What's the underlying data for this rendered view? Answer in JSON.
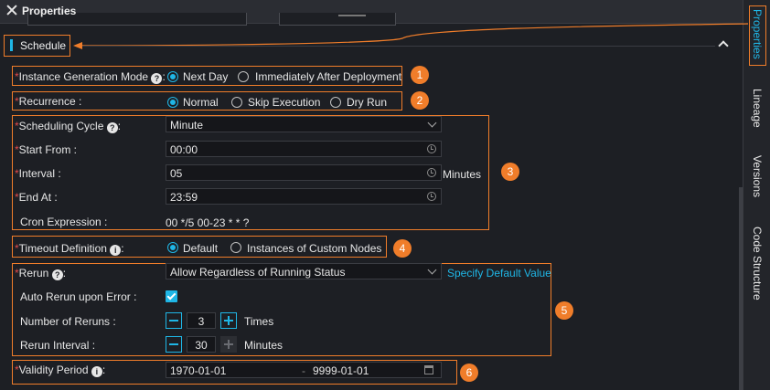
{
  "header": {
    "title": "Properties"
  },
  "sidebar": {
    "tabs": [
      {
        "label": "Properties",
        "active": true
      },
      {
        "label": "Lineage",
        "active": false
      },
      {
        "label": "Versions",
        "active": false
      },
      {
        "label": "Code Structure",
        "active": false
      }
    ]
  },
  "section": {
    "title": "Schedule"
  },
  "badges": [
    "1",
    "2",
    "3",
    "4",
    "5",
    "6"
  ],
  "instance_mode": {
    "label": "Instance Generation Mode",
    "help": "?",
    "options": [
      "Next Day",
      "Immediately After Deployment"
    ],
    "selected": "Next Day"
  },
  "recurrence": {
    "label": "Recurrence :",
    "options": [
      "Normal",
      "Skip Execution",
      "Dry Run"
    ],
    "selected": "Normal"
  },
  "cycle": {
    "scheduling_label": "Scheduling Cycle",
    "help": "?",
    "scheduling_value": "Minute",
    "start_label": "Start From :",
    "start_value": "00:00",
    "interval_label": "Interval :",
    "interval_value": "05",
    "interval_unit": "Minutes",
    "end_label": "End At :",
    "end_value": "23:59",
    "cron_label": "Cron Expression :",
    "cron_value": "00 */5 00-23 * * ?"
  },
  "timeout": {
    "label": "Timeout Definition",
    "help": "i",
    "options": [
      "Default",
      "Instances of Custom Nodes"
    ],
    "selected": "Default"
  },
  "rerun": {
    "label": "Rerun",
    "help": "?",
    "value": "Allow Regardless of Running Status",
    "link": "Specify Default Value",
    "auto_label": "Auto Rerun upon Error :",
    "auto_checked": true,
    "count_label": "Number of Reruns :",
    "count_value": "3",
    "count_unit": "Times",
    "interval_label": "Rerun Interval :",
    "interval_value": "30",
    "interval_unit": "Minutes"
  },
  "validity": {
    "label": "Validity Period",
    "help": "i",
    "start": "1970-01-01",
    "separator": "-",
    "end": "9999-01-01"
  },
  "colors": {
    "accent": "#1fb6e6",
    "annotation": "#f07d2a",
    "required": "#e24b4b",
    "background": "#1d1f24"
  }
}
